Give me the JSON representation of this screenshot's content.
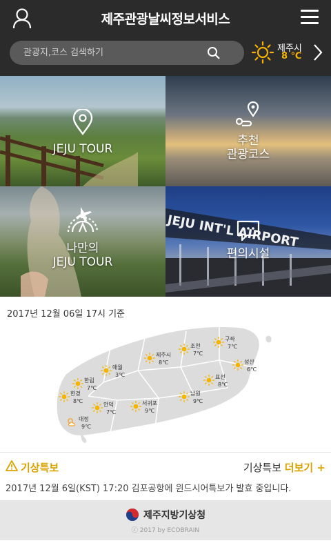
{
  "header": {
    "title": "제주관광날씨정보서비스",
    "user_icon": "user-icon",
    "menu_icon": "hamburger-menu-icon"
  },
  "search": {
    "placeholder": "관광지,코스 검색하기",
    "icon": "search-icon"
  },
  "current_weather": {
    "city": "제주시",
    "temp": "8 ℃",
    "icon": "sun-icon",
    "next_icon": "chevron-right-icon"
  },
  "tiles": [
    {
      "label_line1": "JEJU TOUR",
      "label_line2": "",
      "icon": "location-pin-icon"
    },
    {
      "label_line1": "추천",
      "label_line2": "관광코스",
      "icon": "route-icon"
    },
    {
      "label_line1": "나만의",
      "label_line2": "JEJU TOUR",
      "icon": "airplane-globe-icon"
    },
    {
      "label_line1": "편의시설",
      "label_line2": "",
      "icon": "chat-bubble-icon"
    }
  ],
  "forecast": {
    "as_of": "2017년 12월 06일 17시 기준",
    "stations": [
      {
        "name": "구좌",
        "temp": "7℃",
        "weather": "sunny"
      },
      {
        "name": "조천",
        "temp": "7℃",
        "weather": "sunny"
      },
      {
        "name": "제주시",
        "temp": "8℃",
        "weather": "sunny"
      },
      {
        "name": "애월",
        "temp": "3℃",
        "weather": "sunny"
      },
      {
        "name": "성산",
        "temp": "6℃",
        "weather": "sunny"
      },
      {
        "name": "표선",
        "temp": "8℃",
        "weather": "sunny"
      },
      {
        "name": "한림",
        "temp": "7℃",
        "weather": "sunny"
      },
      {
        "name": "한경",
        "temp": "8℃",
        "weather": "sunny"
      },
      {
        "name": "안덕",
        "temp": "7℃",
        "weather": "sunny"
      },
      {
        "name": "서귀포",
        "temp": "9℃",
        "weather": "sunny"
      },
      {
        "name": "남원",
        "temp": "9℃",
        "weather": "sunny"
      },
      {
        "name": "대정",
        "temp": "9℃",
        "weather": "partly-cloudy"
      }
    ]
  },
  "alert": {
    "title": "기상특보",
    "more_prefix": "기상특보",
    "more_link": "더보기 +",
    "message": "2017년 12월 6일(KST) 17:20 김포공항에 윈드시어특보가 발효 중입니다."
  },
  "footer": {
    "org": "제주지방기상청",
    "copyright": "ⓒ 2017 by ECOBRAIN"
  },
  "colors": {
    "header_bg": "#2b2b2b",
    "accent": "#d9a300",
    "temp_accent": "#f4b400",
    "footer_bg": "#e6e6e6"
  }
}
